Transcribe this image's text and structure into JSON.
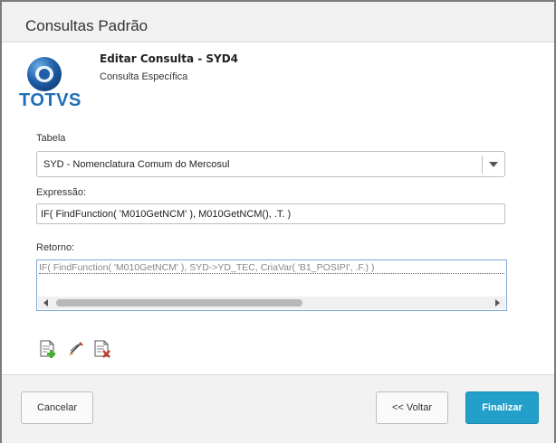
{
  "window": {
    "title": "Consultas Padrão"
  },
  "logo": {
    "brand": "TOTVS"
  },
  "header": {
    "title": "Editar Consulta - SYD4",
    "subtitle": "Consulta Específica"
  },
  "form": {
    "tabela_label": "Tabela",
    "tabela_value": "SYD - Nomenclatura Comum do Mercosul",
    "expressao_label": "Expressão:",
    "expressao_value": "IF( FindFunction( 'M010GetNCM' ), M010GetNCM(), .T. )",
    "retorno_label": "Retorno:",
    "retorno_value": "IF( FindFunction( 'M010GetNCM' ), SYD->YD_TEC,  CriaVar( 'B1_POSIPI', .F.) )"
  },
  "toolbar": {
    "icons": [
      "add-document-icon",
      "edit-brush-icon",
      "delete-document-icon"
    ]
  },
  "footer": {
    "cancel_label": "Cancelar",
    "back_label": "<< Voltar",
    "finish_label": "Finalizar"
  },
  "colors": {
    "accent": "#23a0c9",
    "brand": "#1f6fb7"
  }
}
